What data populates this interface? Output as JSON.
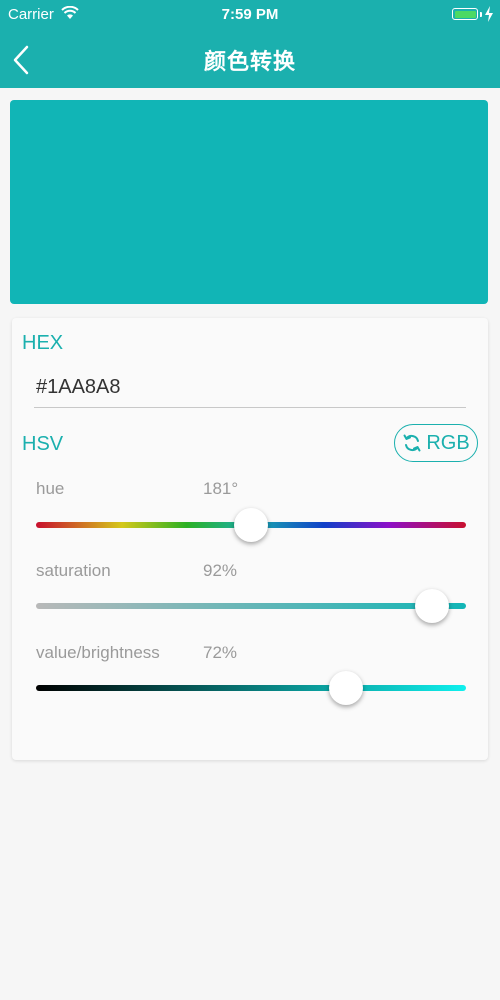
{
  "status_bar": {
    "carrier": "Carrier",
    "time": "7:59 PM"
  },
  "nav": {
    "title": "颜色转换"
  },
  "preview": {
    "color": "#11B5B6"
  },
  "hex": {
    "label": "HEX",
    "value": "#1AA8A8"
  },
  "hsv": {
    "label": "HSV",
    "toggle_label": "RGB",
    "hue": {
      "label": "hue",
      "value_text": "181°",
      "fraction": 0.5
    },
    "saturation": {
      "label": "saturation",
      "value_text": "92%",
      "fraction": 0.92
    },
    "brightness": {
      "label": "value/brightness",
      "value_text": "72%",
      "fraction": 0.72
    }
  },
  "colors": {
    "accent": "#1BB0AE",
    "battery": "#4CD964"
  }
}
